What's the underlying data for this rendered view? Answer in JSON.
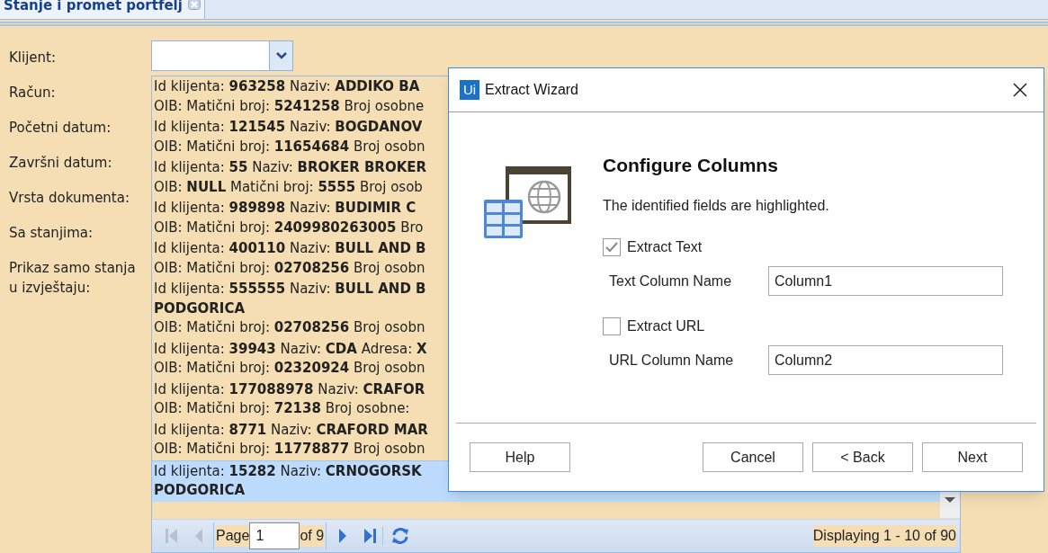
{
  "tab": {
    "label": "Stanje i promet portfelj"
  },
  "form": {
    "labels": [
      "Klijent:",
      "Račun:",
      "Početni datum:",
      "Završni datum:",
      "Vrsta dokumenta:",
      "Sa stanjima:",
      "Prikaz samo stanja u izvještaju:"
    ]
  },
  "dropdown": {
    "items": [
      {
        "lines": [
          "Id klijenta: **963258** Naziv: **ADDIKO BA**",
          "OIB: Matični broj: **5241258** Broj osobne"
        ],
        "selected": false
      },
      {
        "lines": [
          "Id klijenta: **121545** Naziv: **BOGDANOV**",
          "OIB: Matični broj: **11654684** Broj osobn"
        ],
        "selected": false
      },
      {
        "lines": [
          "Id klijenta: **55** Naziv: **BROKER BROKER**",
          "OIB: **NULL** Matični broj: **5555** Broj osob"
        ],
        "selected": false
      },
      {
        "lines": [
          "Id klijenta: **989898** Naziv: **BUDIMIR C**",
          "OIB: Matični broj: **2409980263005** Bro"
        ],
        "selected": false
      },
      {
        "lines": [
          "Id klijenta: **400110** Naziv: **BULL AND B**",
          "OIB: Matični broj: **02708256** Broj osobn"
        ],
        "selected": false
      },
      {
        "lines": [
          "Id klijenta: **555555** Naziv: **BULL AND B**",
          "**PODGORICA**",
          "OIB: Matični broj: **02708256** Broj osobn"
        ],
        "selected": false
      },
      {
        "lines": [
          "Id klijenta: **39943** Naziv: **CDA** Adresa: **X**",
          "OIB: Matični broj: **02320924** Broj osobn"
        ],
        "selected": false
      },
      {
        "lines": [
          "Id klijenta: **177088978** Naziv: **CRAFOR**",
          "OIB: Matični broj: **72138** Broj osobne:"
        ],
        "selected": false
      },
      {
        "lines": [
          "Id klijenta: **8771** Naziv: **CRAFORD MAR**",
          "OIB: Matični broj: **11778877** Broj osobn"
        ],
        "selected": false
      },
      {
        "lines": [
          "Id klijenta: **15282** Naziv: **CRNOGORSK**",
          "**PODGORICA**"
        ],
        "selected": true
      }
    ],
    "pager": {
      "buttons": [
        {
          "kind": "first",
          "disabled": true
        },
        {
          "kind": "prev",
          "disabled": true
        },
        {
          "kind": "page"
        },
        {
          "kind": "next",
          "disabled": false
        },
        {
          "kind": "last",
          "disabled": false
        },
        {
          "kind": "refresh",
          "disabled": false
        }
      ],
      "page_label": "Page",
      "page_value": "1",
      "of_label": "of 9",
      "display": "Displaying 1 - 10 of 90"
    }
  },
  "dialog": {
    "logo": "Ui",
    "title": "Extract Wizard",
    "heading": "Configure Columns",
    "description": "The identified fields are highlighted.",
    "options": [
      {
        "label": "Extract Text",
        "checked": true,
        "field_label": "Text Column Name",
        "field_value": "Column1"
      },
      {
        "label": "Extract URL",
        "checked": false,
        "field_label": "URL Column Name",
        "field_value": "Column2"
      }
    ],
    "buttons": [
      {
        "label": "Help"
      },
      {
        "label": "Cancel"
      },
      {
        "label": "< Back"
      },
      {
        "label": "Next"
      }
    ]
  }
}
